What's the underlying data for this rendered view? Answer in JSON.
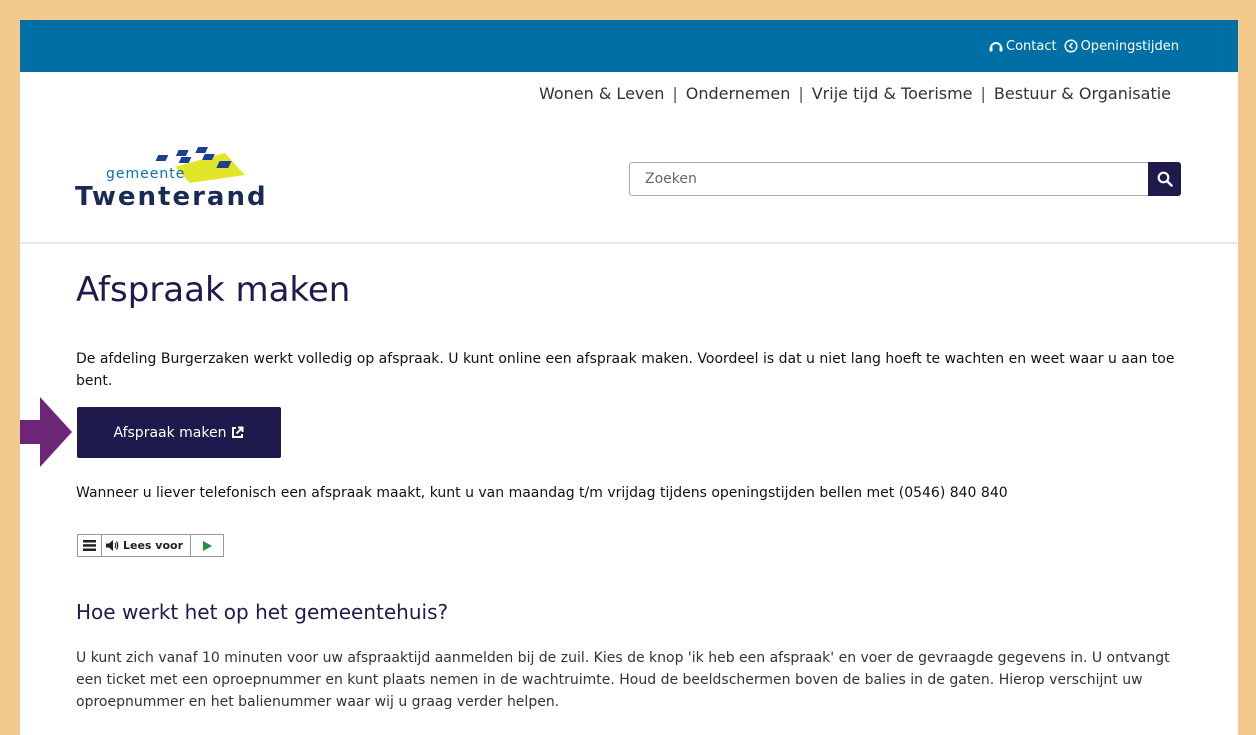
{
  "topbar": {
    "contact_label": "Contact",
    "hours_label": "Openingstijden",
    "background": "#006fa6"
  },
  "nav": {
    "items": [
      "Wonen & Leven",
      "Ondernemen",
      "Vrije tijd & Toerisme",
      "Bestuur & Organisatie"
    ],
    "separator": "|"
  },
  "logo": {
    "small_text": "gemeente",
    "big_text": "Twenterand"
  },
  "search": {
    "placeholder": "Zoeken",
    "icon": "search-icon"
  },
  "main": {
    "title": "Afspraak maken",
    "intro": "De afdeling Burgerzaken werkt volledig op afspraak. U kunt online een afspraak maken. Voordeel is dat u niet lang hoeft te wachten en weet waar u aan toe bent.",
    "cta_label": "Afspraak maken",
    "phone_text": "Wanneer u liever telefonisch een afspraak maakt, kunt u van maandag t/m vrijdag tijdens openingstijden bellen met (0546) 840 840",
    "readspeaker_label": "Lees voor",
    "section_heading": "Hoe werkt het op het gemeentehuis?",
    "body_text": "U kunt zich vanaf 10 minuten voor uw afspraaktijd aanmelden bij de zuil. Kies de knop 'ik heb een afspraak' en voer de gevraagde gegevens in. U ontvangt een ticket met een oproepnummer en kunt plaats nemen in de wachtruimte. Houd de beeldschermen boven de balies in de gaten. Hierop verschijnt uw oproepnummer en het balienummer waar wij u graag verder helpen."
  },
  "colors": {
    "primary": "#1e1a4d",
    "accent_arrow": "#6d2677",
    "frame": "#f4c98e"
  }
}
